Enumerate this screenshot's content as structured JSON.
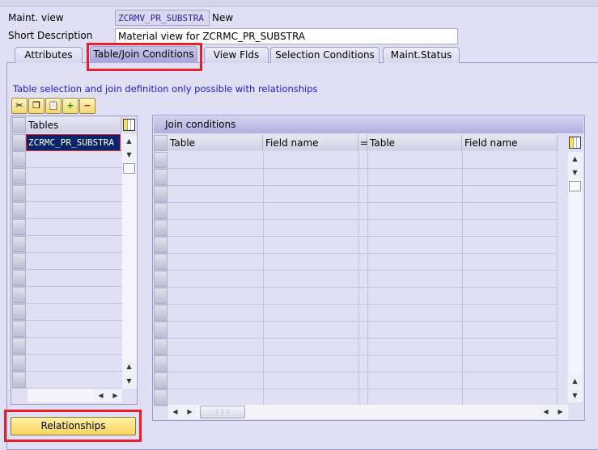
{
  "header": {
    "maint_view_label": "Maint. view",
    "maint_view_value": "ZCRMV_PR_SUBSTRA",
    "status": "New",
    "short_desc_label": "Short Description",
    "short_desc_value": "Material view for ZCRMC_PR_SUBSTRA"
  },
  "tabs": [
    {
      "label": "Attributes"
    },
    {
      "label": "Table/Join Conditions",
      "active": true
    },
    {
      "label": "View Flds"
    },
    {
      "label": "Selection Conditions"
    },
    {
      "label": "Maint.Status"
    }
  ],
  "info_text": "Table selection and join definition only possible with relationships",
  "toolbar": [
    {
      "icon": "cut-icon",
      "glyph": "✂"
    },
    {
      "icon": "copy-icon",
      "glyph": "❐"
    },
    {
      "icon": "paste-icon",
      "glyph": "📋"
    },
    {
      "icon": "insert-row-icon",
      "glyph": "+"
    },
    {
      "icon": "delete-row-icon",
      "glyph": "−"
    }
  ],
  "tables": {
    "header": "Tables",
    "rows": [
      "ZCRMC_PR_SUBSTRA"
    ]
  },
  "join": {
    "title": "Join conditions",
    "columns": [
      "Table",
      "Field name",
      "=",
      "Table",
      "Field name"
    ]
  },
  "relationships_button": "Relationships",
  "colors": {
    "highlight": "#e8202a",
    "selected_cell": "#0a246a",
    "info_text": "#1a1ae0"
  }
}
